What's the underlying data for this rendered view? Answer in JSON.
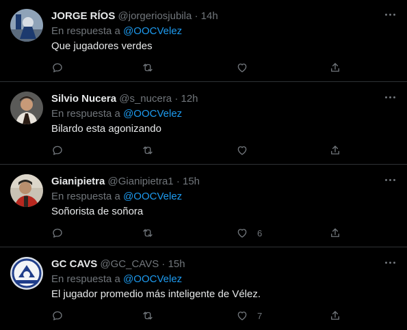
{
  "replies": [
    {
      "display_name": "JORGE RÍOS",
      "handle": "@jorgeriosjubila",
      "separator": "·",
      "time": "14h",
      "replying_prefix": "En respuesta a",
      "replying_to": "@OOCVelez",
      "text": "Que jugadores verdes",
      "likes": "",
      "avatar_colors": [
        "#8fa3b8",
        "#1c3a6e",
        "#d7dde4"
      ]
    },
    {
      "display_name": "Silvio Nucera",
      "handle": "@s_nucera",
      "separator": "·",
      "time": "12h",
      "replying_prefix": "En respuesta a",
      "replying_to": "@OOCVelez",
      "text": "Bilardo esta agonizando",
      "likes": "",
      "avatar_colors": [
        "#5a5a58",
        "#2b1d15",
        "#e9e4dc"
      ]
    },
    {
      "display_name": "Gianipietra",
      "handle": "@Gianipietra1",
      "separator": "·",
      "time": "15h",
      "replying_prefix": "En respuesta a",
      "replying_to": "@OOCVelez",
      "text": "Soñorista de soñora",
      "likes": "6",
      "avatar_colors": [
        "#c9c2b4",
        "#b8281f",
        "#2a2621"
      ]
    },
    {
      "display_name": "GC CAVS",
      "handle": "@GC_CAVS",
      "separator": "·",
      "time": "15h",
      "replying_prefix": "En respuesta a",
      "replying_to": "@OOCVelez",
      "text": "El jugador promedio más inteligente de Vélez.",
      "likes": "7",
      "avatar_colors": [
        "#d9dfe8",
        "#1f3d8a",
        "#f2f4f7"
      ]
    }
  ],
  "icons": {
    "reply": "reply-icon",
    "retweet": "retweet-icon",
    "like": "heart-icon",
    "share": "share-icon",
    "more": "more-icon"
  },
  "colors": {
    "background": "#000000",
    "primary_text": "#e7e9ea",
    "secondary_text": "#71767b",
    "link": "#1d9bf0",
    "divider": "#2f3336"
  }
}
